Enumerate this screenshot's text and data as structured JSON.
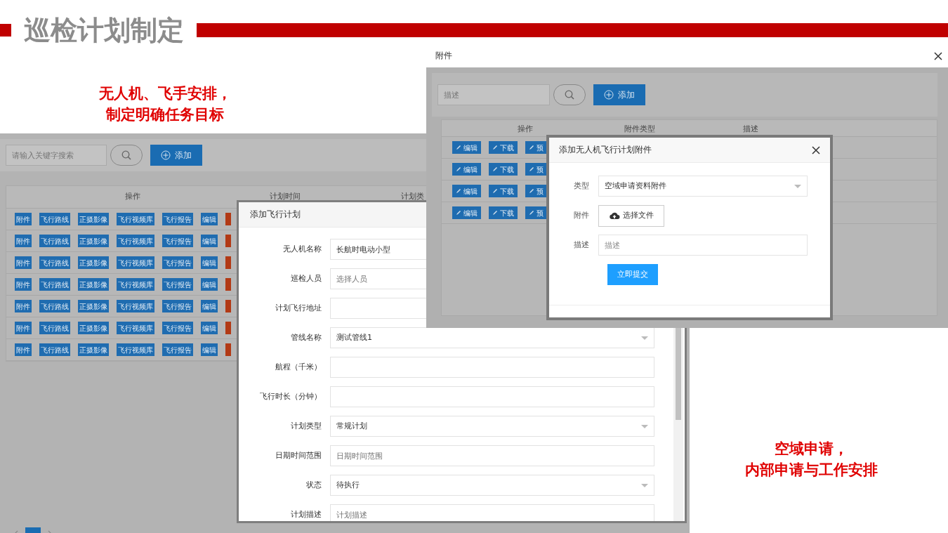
{
  "slide": {
    "title": "巡检计划制定",
    "captions": [
      {
        "lines": [
          "无人机、飞手安排，",
          "制定明确任务目标"
        ]
      },
      {
        "lines": [
          "空域申请，",
          "内部申请与工作安排"
        ]
      }
    ]
  },
  "plan_list": {
    "search": {
      "placeholder": "请输入关键字搜索"
    },
    "add_button": "添加",
    "columns": [
      "操作",
      "计划时间",
      "计划类"
    ],
    "rows": [
      {
        "actions": [
          "附件",
          "飞行路线",
          "正摄影像",
          "飞行视频库",
          "飞行报告",
          "编辑"
        ]
      },
      {
        "actions": [
          "附件",
          "飞行路线",
          "正摄影像",
          "飞行视频库",
          "飞行报告",
          "编辑"
        ]
      },
      {
        "actions": [
          "附件",
          "飞行路线",
          "正摄影像",
          "飞行视频库",
          "飞行报告",
          "编辑"
        ]
      },
      {
        "actions": [
          "附件",
          "飞行路线",
          "正摄影像",
          "飞行视频库",
          "飞行报告",
          "编辑"
        ]
      },
      {
        "actions": [
          "附件",
          "飞行路线",
          "正摄影像",
          "飞行视频库",
          "飞行报告",
          "编辑"
        ]
      },
      {
        "actions": [
          "附件",
          "飞行路线",
          "正摄影像",
          "飞行视频库",
          "飞行报告",
          "编辑"
        ]
      },
      {
        "actions": [
          "附件",
          "飞行路线",
          "正摄影像",
          "飞行视频库",
          "飞行报告",
          "编辑"
        ]
      }
    ],
    "pagination": {
      "pages": [
        {
          "selected": true
        }
      ]
    }
  },
  "flight_plan_dialog": {
    "title": "添加飞行计划",
    "fields": [
      {
        "label": "无人机名称",
        "kind": "text",
        "value": "长航时电动小型"
      },
      {
        "label": "巡检人员",
        "kind": "text",
        "placeholder": "选择人员"
      },
      {
        "label": "计划飞行地址",
        "kind": "text"
      },
      {
        "label": "管线名称",
        "kind": "select",
        "value": "测试管线1"
      },
      {
        "label": "航程（千米）",
        "kind": "text"
      },
      {
        "label": "飞行时长（分钟）",
        "kind": "text"
      },
      {
        "label": "计划类型",
        "kind": "select",
        "value": "常规计划"
      },
      {
        "label": "日期时间范围",
        "kind": "text",
        "placeholder": "日期时间范围"
      },
      {
        "label": "状态",
        "kind": "select",
        "value": "待执行"
      },
      {
        "label": "计划描述",
        "kind": "text",
        "placeholder": "计划描述"
      }
    ]
  },
  "attachment_window": {
    "title": "附件",
    "search": {
      "placeholder": "描述"
    },
    "add_button": "添加",
    "columns": [
      "操作",
      "附件类型",
      "描述"
    ],
    "rows": [
      {
        "actions": [
          "编辑",
          "下载",
          "预"
        ]
      },
      {
        "actions": [
          "编辑",
          "下载",
          "预"
        ]
      },
      {
        "actions": [
          "编辑",
          "下载",
          "预"
        ]
      },
      {
        "actions": [
          "编辑",
          "下载",
          "预"
        ]
      }
    ]
  },
  "attachment_dialog": {
    "title": "添加无人机飞行计划附件",
    "fields": [
      {
        "label": "类型",
        "kind": "select",
        "value": "空域申请资料附件"
      },
      {
        "label": "附件",
        "kind": "file",
        "button": "选择文件"
      },
      {
        "label": "描述",
        "kind": "text",
        "placeholder": "描述"
      }
    ],
    "submit": "立即提交"
  }
}
